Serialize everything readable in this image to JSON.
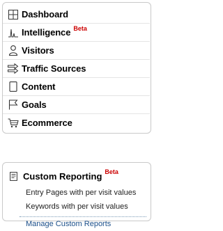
{
  "nav": {
    "items": [
      {
        "label": "Dashboard",
        "icon": "dashboard-grid-icon"
      },
      {
        "label": "Intelligence",
        "icon": "intelligence-pulse-icon",
        "badge": "Beta"
      },
      {
        "label": "Visitors",
        "icon": "visitor-person-icon"
      },
      {
        "label": "Traffic Sources",
        "icon": "traffic-arrows-icon"
      },
      {
        "label": "Content",
        "icon": "content-page-icon"
      },
      {
        "label": "Goals",
        "icon": "goal-flag-icon"
      },
      {
        "label": "Ecommerce",
        "icon": "shopping-cart-icon"
      }
    ]
  },
  "custom_reporting": {
    "title": "Custom Reporting",
    "badge": "Beta",
    "icon": "report-document-icon",
    "links": [
      "Entry Pages with per visit values",
      "Keywords with per visit values"
    ],
    "manage_label": "Manage Custom Reports"
  },
  "colors": {
    "beta": "#cc0000",
    "manage_link": "#1b4f8a",
    "panel_border": "#c9c9c9"
  }
}
